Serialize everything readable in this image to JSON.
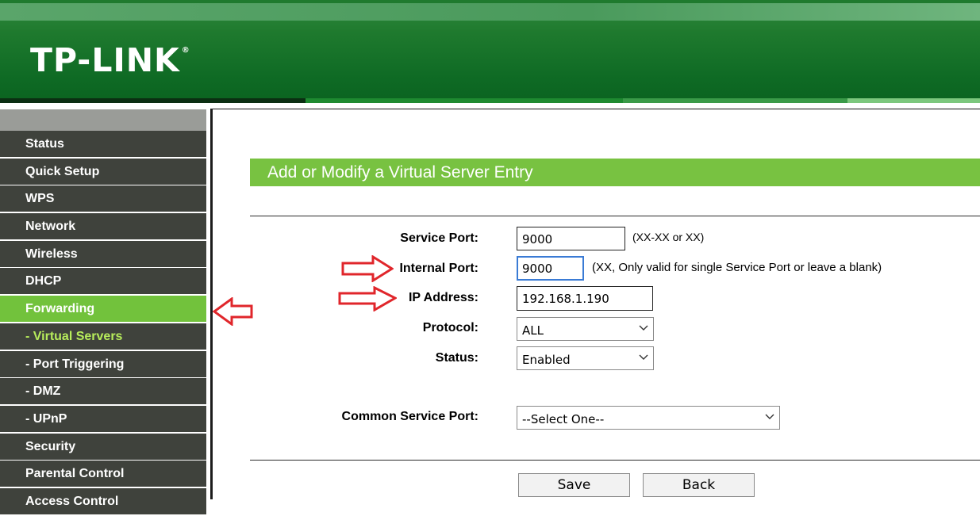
{
  "brand": {
    "logo_text": "TP-LINK",
    "reg_mark": "®"
  },
  "sidebar": {
    "items": [
      {
        "label": "Status",
        "state": "normal"
      },
      {
        "label": "Quick Setup",
        "state": "normal"
      },
      {
        "label": "WPS",
        "state": "normal"
      },
      {
        "label": "Network",
        "state": "normal"
      },
      {
        "label": "Wireless",
        "state": "normal"
      },
      {
        "label": "DHCP",
        "state": "normal"
      },
      {
        "label": "Forwarding",
        "state": "active"
      },
      {
        "label": "- Virtual Servers",
        "state": "sub-active"
      },
      {
        "label": "- Port Triggering",
        "state": "normal"
      },
      {
        "label": "- DMZ",
        "state": "normal"
      },
      {
        "label": "- UPnP",
        "state": "normal"
      },
      {
        "label": "Security",
        "state": "normal"
      },
      {
        "label": "Parental Control",
        "state": "normal"
      },
      {
        "label": "Access Control",
        "state": "normal"
      }
    ]
  },
  "form": {
    "title": "Add or Modify a Virtual Server Entry",
    "service_port": {
      "label": "Service Port:",
      "value": "9000",
      "hint": "(XX-XX or XX)"
    },
    "internal_port": {
      "label": "Internal Port:",
      "value": "9000",
      "hint": "(XX, Only valid for single Service Port or leave a blank)"
    },
    "ip_address": {
      "label": "IP Address:",
      "value": "192.168.1.190"
    },
    "protocol": {
      "label": "Protocol:",
      "value": "ALL"
    },
    "status": {
      "label": "Status:",
      "value": "Enabled"
    },
    "common_service_port": {
      "label": "Common Service Port:",
      "value": "--Select One--"
    },
    "save_label": "Save",
    "back_label": "Back"
  },
  "colors": {
    "header_green": "#1f7a2e",
    "menu_dark": "#3f423c",
    "menu_active": "#72c23c",
    "title_bar": "#78c241",
    "annotation_arrow": "#e0262b"
  },
  "icons": {
    "dropdown": "chevron-down-icon",
    "annotation": "red-arrow-icon"
  }
}
